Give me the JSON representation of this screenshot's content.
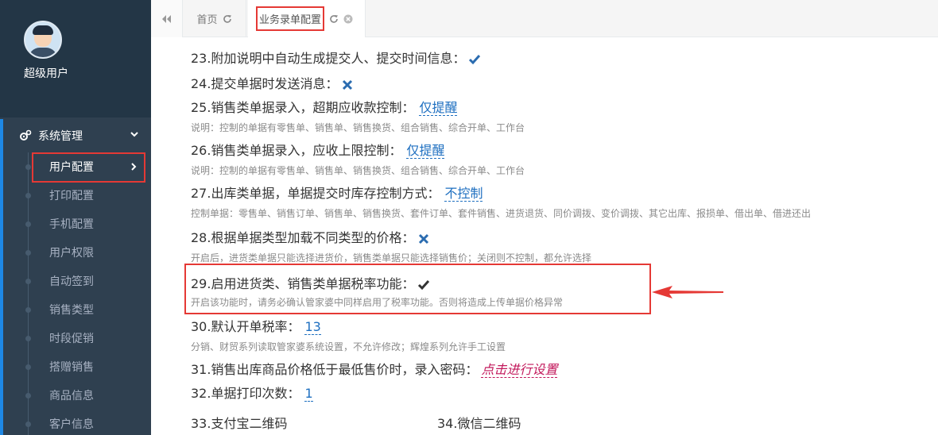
{
  "sidebar": {
    "user_name": "超级用户",
    "menu_title": "系统管理",
    "items": [
      {
        "label": "用户配置",
        "active": true
      },
      {
        "label": "打印配置"
      },
      {
        "label": "手机配置"
      },
      {
        "label": "用户权限"
      },
      {
        "label": "自动签到"
      },
      {
        "label": "销售类型"
      },
      {
        "label": "时段促销"
      },
      {
        "label": "搭赠销售"
      },
      {
        "label": "商品信息"
      },
      {
        "label": "客户信息"
      }
    ]
  },
  "tabs": {
    "home_label": "首页",
    "current_label": "业务录单配置"
  },
  "settings": {
    "s23": {
      "label": "23.附加说明中自动生成提交人、提交时间信息：",
      "state": "check"
    },
    "s24": {
      "label": "24.提交单据时发送消息：",
      "state": "cross"
    },
    "s25": {
      "label": "25.销售类单据录入，超期应收款控制：",
      "value": "仅提醒",
      "note": "说明：控制的单据有零售单、销售单、销售换货、组合销售、综合开单、工作台"
    },
    "s26": {
      "label": "26.销售类单据录入，应收上限控制：",
      "value": "仅提醒",
      "note": "说明：控制的单据有零售单、销售单、销售换货、组合销售、综合开单、工作台"
    },
    "s27": {
      "label": "27.出库类单据，单据提交时库存控制方式：",
      "value": "不控制",
      "note": "控制单据：零售单、销售订单、销售单、销售换货、套件订单、套件销售、进货退货、同价调拨、变价调拨、其它出库、报损单、借出单、借进还出"
    },
    "s28": {
      "label": "28.根据单据类型加载不同类型的价格：",
      "state": "cross",
      "note": "开启后，进货类单据只能选择进货价，销售类单据只能选择销售价；关闭则不控制，都允许选择"
    },
    "s29": {
      "label": "29.启用进货类、销售类单据税率功能：",
      "state": "check",
      "note": "开启该功能时，请务必确认管家婆中同样启用了税率功能。否则将造成上传单据价格异常"
    },
    "s30": {
      "label": "30.默认开单税率：",
      "value": "13",
      "note": "分销、财贸系列读取管家婆系统设置，不允许修改；辉煌系列允许手工设置"
    },
    "s31": {
      "label": "31.销售出库商品价格低于最低售价时，录入密码：",
      "value": "点击进行设置"
    },
    "s32": {
      "label": "32.单据打印次数：",
      "value": "1"
    },
    "s33": {
      "label": "33.支付宝二维码"
    },
    "s34": {
      "label": "34.微信二维码"
    }
  },
  "icons": {
    "check": "check-icon",
    "cross": "cross-icon"
  },
  "colors": {
    "sidebar_bg": "#2f4050",
    "accent_blue": "#1e6fc0",
    "highlight_red": "#e53935"
  }
}
